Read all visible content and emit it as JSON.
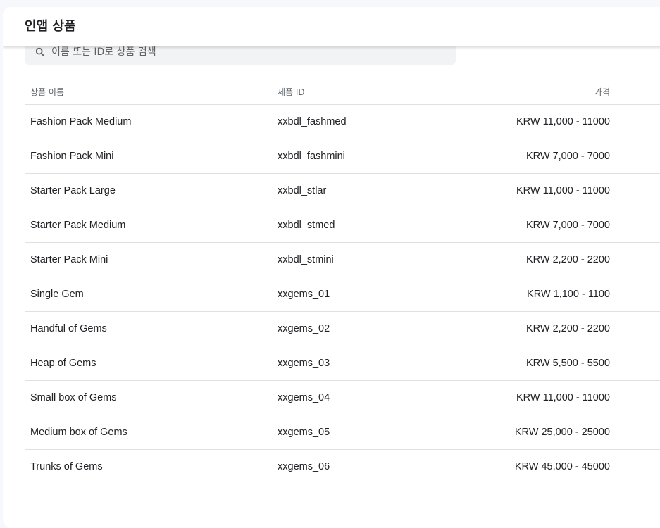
{
  "header": {
    "title": "인앱 상품"
  },
  "search": {
    "placeholder": "이름 또는 ID로 상품 검색",
    "value": ""
  },
  "table": {
    "columns": {
      "name": "상품 이름",
      "id": "제품 ID",
      "price": "가격"
    },
    "rows": [
      {
        "name": "Fashion Pack Medium",
        "id": "xxbdl_fashmed",
        "price": "KRW 11,000 - 11000"
      },
      {
        "name": "Fashion Pack Mini",
        "id": "xxbdl_fashmini",
        "price": "KRW 7,000 - 7000"
      },
      {
        "name": "Starter Pack Large",
        "id": "xxbdl_stlar",
        "price": "KRW 11,000 - 11000"
      },
      {
        "name": "Starter Pack Medium",
        "id": "xxbdl_stmed",
        "price": "KRW 7,000 - 7000"
      },
      {
        "name": "Starter Pack Mini",
        "id": "xxbdl_stmini",
        "price": "KRW 2,200 - 2200"
      },
      {
        "name": "Single Gem",
        "id": "xxgems_01",
        "price": "KRW 1,100 - 1100"
      },
      {
        "name": "Handful of Gems",
        "id": "xxgems_02",
        "price": "KRW 2,200 - 2200"
      },
      {
        "name": "Heap of Gems",
        "id": "xxgems_03",
        "price": "KRW 5,500 - 5500"
      },
      {
        "name": "Small box of Gems",
        "id": "xxgems_04",
        "price": "KRW 11,000 - 11000"
      },
      {
        "name": "Medium box of Gems",
        "id": "xxgems_05",
        "price": "KRW 25,000 - 25000"
      },
      {
        "name": "Trunks of Gems",
        "id": "xxgems_06",
        "price": "KRW 45,000 - 45000"
      }
    ]
  },
  "icons": {
    "search": "search-icon"
  },
  "colors": {
    "background": "#f6f8fc",
    "divider": "#e0e0e0",
    "search_bg": "#f1f3f4"
  }
}
